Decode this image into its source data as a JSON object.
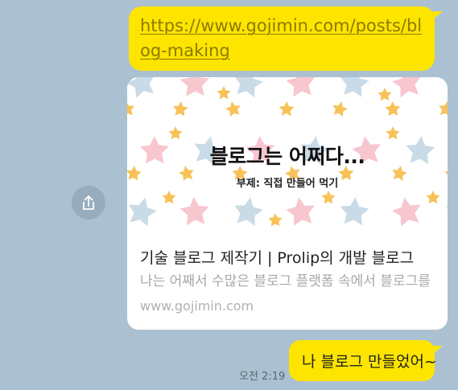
{
  "messages": {
    "link": {
      "url_text": "https://www.gojimin.com/posts/blog-making"
    },
    "preview": {
      "image": {
        "headline": "블로그는 어쩌다...",
        "subheadline": "부제: 직접 만들어 먹기"
      },
      "title": "기술 블로그 제작기 | Prolip의 개발 블로그",
      "description": "나는 어째서 수많은 블로그 플랫폼 속에서 블로그를 직접 만들게 되었을까",
      "domain": "www.gojimin.com"
    },
    "text": {
      "body": "나 블로그 만들었어~",
      "time": "오전 2:19"
    }
  },
  "share_button": {
    "icon": "share-icon"
  },
  "colors": {
    "chat_background": "#abc1d1",
    "bubble": "#fee500",
    "star_pink": "#f7c6cf",
    "star_blue": "#c9dbe6",
    "star_yellow": "#f7c25a"
  }
}
